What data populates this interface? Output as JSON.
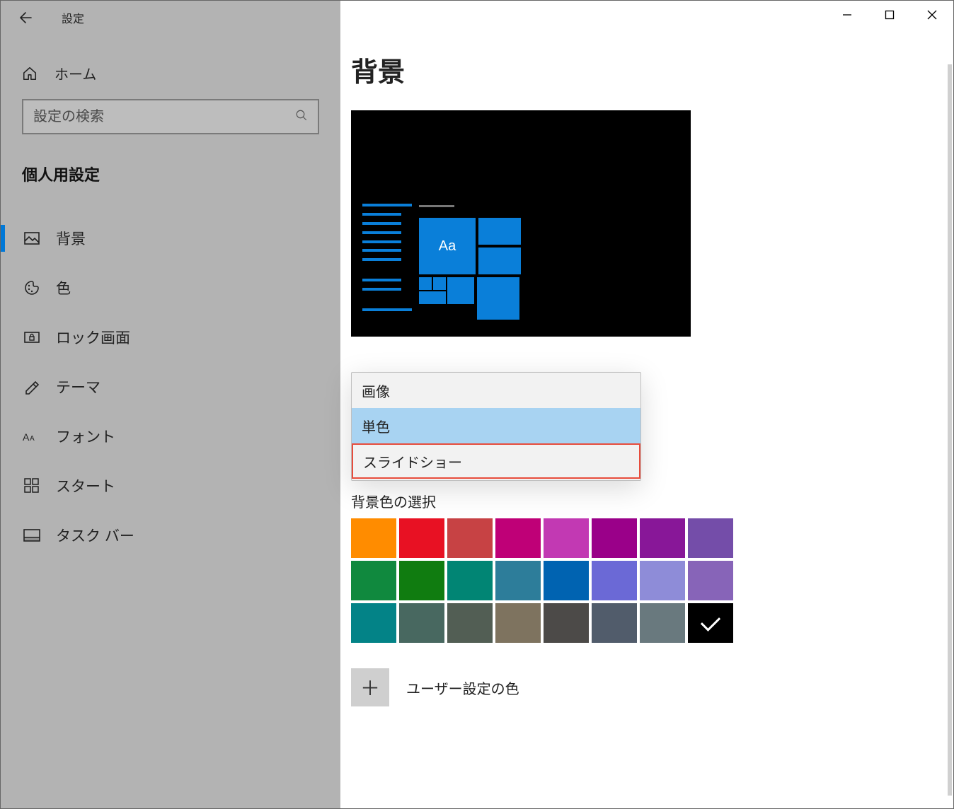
{
  "window": {
    "title": "設定"
  },
  "sidebar": {
    "home": "ホーム",
    "searchPlaceholder": "設定の検索",
    "category": "個人用設定",
    "items": [
      {
        "label": "背景",
        "icon": "background-icon",
        "selected": true
      },
      {
        "label": "色",
        "icon": "colors-icon",
        "selected": false
      },
      {
        "label": "ロック画面",
        "icon": "lockscreen-icon",
        "selected": false
      },
      {
        "label": "テーマ",
        "icon": "themes-icon",
        "selected": false
      },
      {
        "label": "フォント",
        "icon": "fonts-icon",
        "selected": false
      },
      {
        "label": "スタート",
        "icon": "start-icon",
        "selected": false
      },
      {
        "label": "タスク バー",
        "icon": "taskbar-icon",
        "selected": false
      }
    ]
  },
  "main": {
    "title": "背景",
    "previewText": "Aa",
    "dropdown": {
      "options": [
        {
          "label": "画像",
          "selected": false,
          "highlighted": false
        },
        {
          "label": "単色",
          "selected": true,
          "highlighted": false
        },
        {
          "label": "スライドショー",
          "selected": false,
          "highlighted": true
        }
      ]
    },
    "colorSection": "背景色の選択",
    "colors": [
      [
        "#ff8c00",
        "#e81123",
        "#c74244",
        "#bf0077",
        "#c239b3",
        "#9a0089",
        "#881798",
        "#744da9"
      ],
      [
        "#10893e",
        "#107c10",
        "#018574",
        "#2d7d9a",
        "#0063b1",
        "#6b69d6",
        "#8e8cd8",
        "#8764b8"
      ],
      [
        "#038387",
        "#486860",
        "#525e54",
        "#7e735f",
        "#4c4a48",
        "#515c6b",
        "#69797e",
        "#000000"
      ]
    ],
    "selectedColor": "#000000",
    "customColor": "ユーザー設定の色"
  }
}
